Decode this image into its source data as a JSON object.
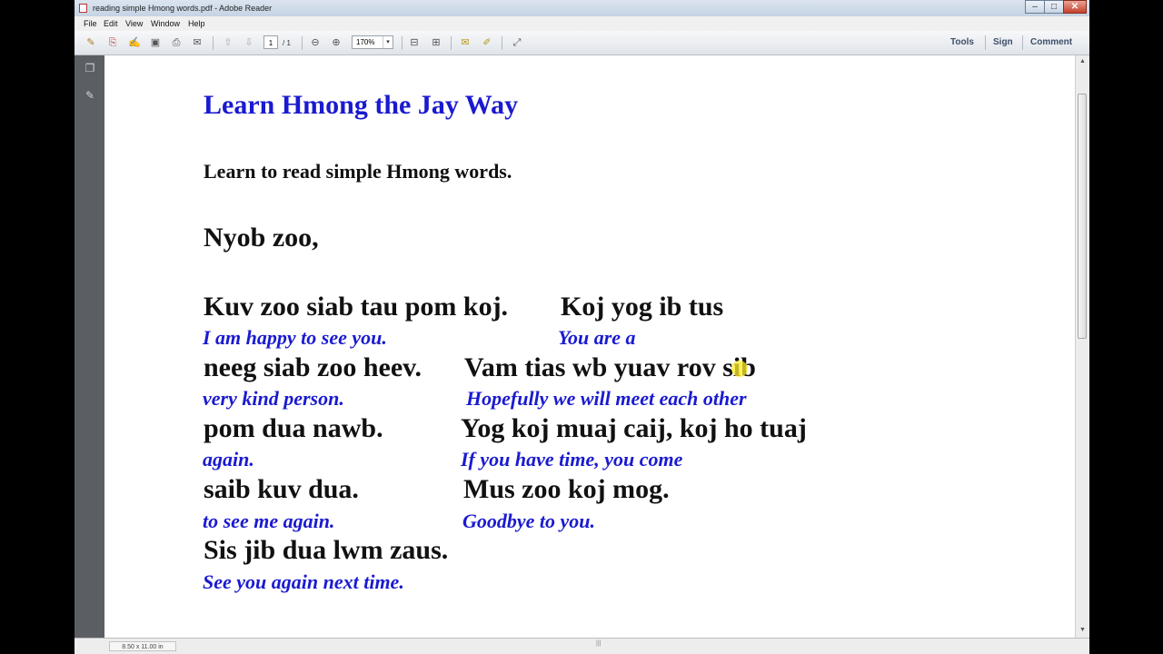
{
  "window": {
    "title": "reading simple Hmong words.pdf - Adobe Reader",
    "minimize_glyph": "–",
    "maximize_glyph": "□",
    "close_glyph": "✕"
  },
  "menu": [
    "File",
    "Edit",
    "View",
    "Window",
    "Help"
  ],
  "toolbar": {
    "current_page": "1",
    "page_total": "/ 1",
    "zoom": "170%",
    "zoom_dropdown_glyph": "▾",
    "icons": [
      "create-pdf-icon",
      "open-icon",
      "sign-icon",
      "save-icon",
      "print-icon",
      "email-icon",
      "previous-page-icon",
      "next-page-icon",
      "zoom-out-icon",
      "zoom-in-icon",
      "fit-page-icon",
      "fit-width-icon",
      "comment-icon",
      "highlight-icon",
      "fullscreen-icon"
    ],
    "tools_label": "Tools",
    "sign_label": "Sign",
    "comment_label": "Comment"
  },
  "document": {
    "title": "Learn Hmong the Jay Way",
    "subtitle": "Learn to read simple Hmong words.",
    "greeting": "Nyob zoo,",
    "lines": [
      {
        "hmong": [
          "Kuv zoo siab tau pom koj.",
          "Koj yog ib tus"
        ],
        "english": [
          "I  am happy to see you.",
          "You are a"
        ]
      },
      {
        "hmong": [
          "neeg siab zoo heev.",
          "Vam tias wb yuav rov sib"
        ],
        "english": [
          "very kind person.",
          "Hopefully we will meet each other"
        ]
      },
      {
        "hmong": [
          "pom dua nawb.",
          "Yog koj muaj caij, koj ho tuaj"
        ],
        "english": [
          "again.",
          "If you have time, you come"
        ]
      },
      {
        "hmong": [
          "saib kuv dua.",
          "Mus zoo koj mog."
        ],
        "english": [
          "to see me again.",
          "Goodbye to you."
        ]
      },
      {
        "hmong": [
          "Sis jib dua lwm zaus."
        ],
        "english": [
          "See you again next time."
        ]
      }
    ]
  },
  "status": {
    "page_size": "8.50 x 11.00 in"
  }
}
